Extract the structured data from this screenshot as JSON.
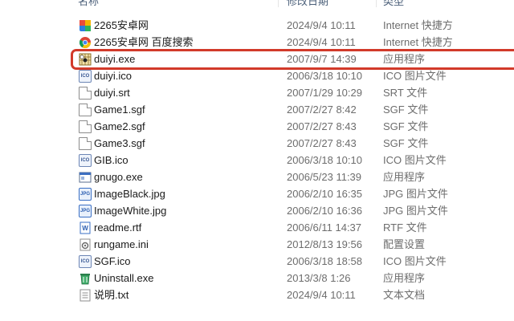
{
  "columns": {
    "name": "名称",
    "date": "修改日期",
    "type": "类型"
  },
  "files": [
    {
      "name": "2265安卓网",
      "date": "2024/9/4 10:11",
      "type": "Internet 快捷方",
      "icon": "internet-shortcut-icon"
    },
    {
      "name": "2265安卓网 百度搜索",
      "date": "2024/9/4 10:11",
      "type": "Internet 快捷方",
      "icon": "chrome-shortcut-icon"
    },
    {
      "name": "duiyi.exe",
      "date": "2007/9/7 14:39",
      "type": "应用程序",
      "icon": "duiyi-app-icon"
    },
    {
      "name": "duiyi.ico",
      "date": "2006/3/18 10:10",
      "type": "ICO 图片文件",
      "icon": "ico-file-icon"
    },
    {
      "name": "duiyi.srt",
      "date": "2007/1/29 10:29",
      "type": "SRT 文件",
      "icon": "document-icon"
    },
    {
      "name": "Game1.sgf",
      "date": "2007/2/27 8:42",
      "type": "SGF 文件",
      "icon": "document-icon"
    },
    {
      "name": "Game2.sgf",
      "date": "2007/2/27 8:43",
      "type": "SGF 文件",
      "icon": "document-icon"
    },
    {
      "name": "Game3.sgf",
      "date": "2007/2/27 8:43",
      "type": "SGF 文件",
      "icon": "document-icon"
    },
    {
      "name": "GIB.ico",
      "date": "2006/3/18 10:10",
      "type": "ICO 图片文件",
      "icon": "ico-file-icon"
    },
    {
      "name": "gnugo.exe",
      "date": "2006/5/23 11:39",
      "type": "应用程序",
      "icon": "application-icon"
    },
    {
      "name": "ImageBlack.jpg",
      "date": "2006/2/10 16:35",
      "type": "JPG 图片文件",
      "icon": "jpg-file-icon"
    },
    {
      "name": "ImageWhite.jpg",
      "date": "2006/2/10 16:36",
      "type": "JPG 图片文件",
      "icon": "jpg-file-icon"
    },
    {
      "name": "readme.rtf",
      "date": "2006/6/11 14:37",
      "type": "RTF 文件",
      "icon": "word-document-icon"
    },
    {
      "name": "rungame.ini",
      "date": "2012/8/13 19:56",
      "type": "配置设置",
      "icon": "config-file-icon"
    },
    {
      "name": "SGF.ico",
      "date": "2006/3/18 18:58",
      "type": "ICO 图片文件",
      "icon": "ico-file-icon"
    },
    {
      "name": "Uninstall.exe",
      "date": "2013/3/8 1:26",
      "type": "应用程序",
      "icon": "uninstaller-icon"
    },
    {
      "name": "说明.txt",
      "date": "2024/9/4 10:11",
      "type": "文本文档",
      "icon": "text-file-icon"
    }
  ],
  "colors": {
    "highlight": "#d23a2a",
    "secondary_text": "#6d6d6d",
    "header_text": "#4c607a"
  }
}
